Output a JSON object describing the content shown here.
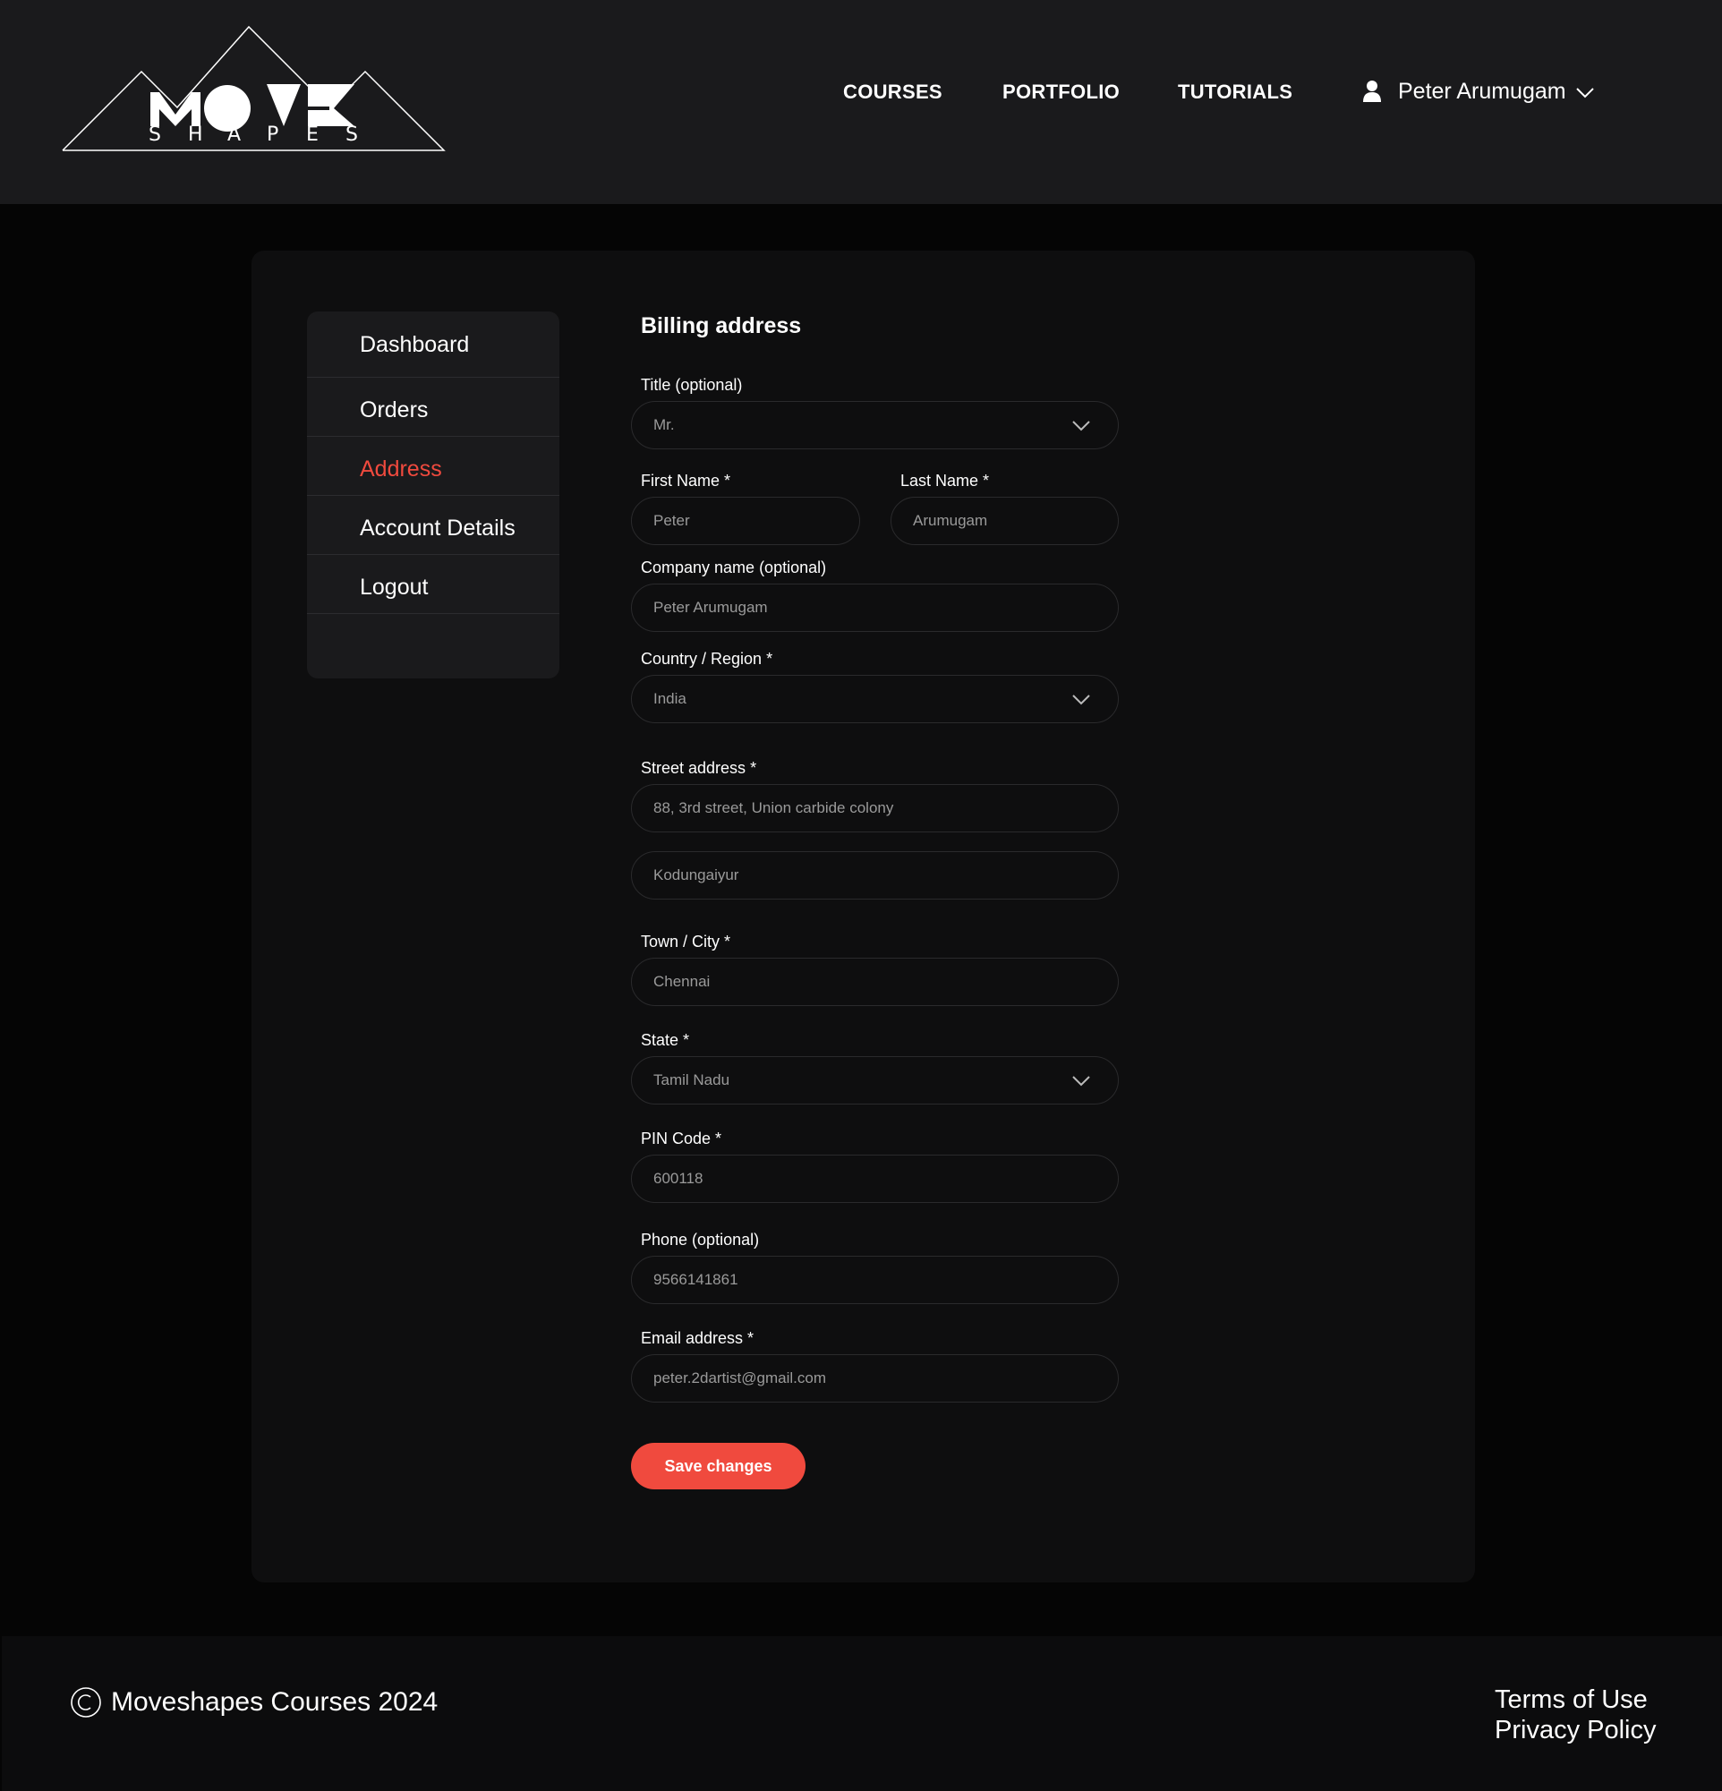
{
  "brand": {
    "logo_word": "MOVE",
    "logo_sub": "SHAPES"
  },
  "nav": {
    "courses": "COURSES",
    "portfolio": "PORTFOLIO",
    "tutorials": "TUTORIALS",
    "user_name": "Peter Arumugam"
  },
  "sidebar": {
    "items": [
      {
        "label": "Dashboard",
        "active": false
      },
      {
        "label": "Orders",
        "active": false
      },
      {
        "label": "Address",
        "active": true
      },
      {
        "label": "Account Details",
        "active": false
      },
      {
        "label": "Logout",
        "active": false
      }
    ]
  },
  "form": {
    "title": "Billing address",
    "title_field": {
      "label": "Title (optional)",
      "value": "Mr."
    },
    "first_name": {
      "label": "First Name *",
      "value": "Peter"
    },
    "last_name": {
      "label": "Last Name *",
      "value": "Arumugam"
    },
    "company": {
      "label": "Company name (optional)",
      "value": "Peter Arumugam"
    },
    "country": {
      "label": "Country / Region *",
      "value": "India"
    },
    "street": {
      "label": "Street address *",
      "line1": "88, 3rd street, Union carbide colony",
      "line2": "Kodungaiyur"
    },
    "city": {
      "label": "Town / City *",
      "value": "Chennai"
    },
    "state": {
      "label": "State *",
      "value": "Tamil Nadu"
    },
    "pin": {
      "label": "PIN Code *",
      "value": "600118"
    },
    "phone": {
      "label": "Phone (optional)",
      "value": "9566141861"
    },
    "email": {
      "label": "Email address *",
      "value": "peter.2dartist@gmail.com"
    },
    "save_label": "Save changes"
  },
  "footer": {
    "copyright": "Moveshapes Courses 2024",
    "terms": "Terms of Use",
    "privacy": "Privacy Policy"
  },
  "colors": {
    "accent": "#f04a3e",
    "header_bg": "#1a1a1c",
    "page_bg": "#050505",
    "card_bg": "#0e0e0f"
  }
}
